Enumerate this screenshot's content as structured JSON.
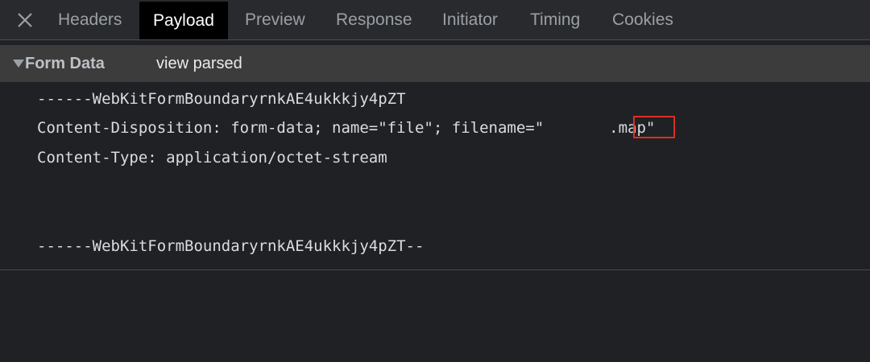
{
  "tabs": [
    {
      "label": "Headers",
      "active": false
    },
    {
      "label": "Payload",
      "active": true
    },
    {
      "label": "Preview",
      "active": false
    },
    {
      "label": "Response",
      "active": false
    },
    {
      "label": "Initiator",
      "active": false
    },
    {
      "label": "Timing",
      "active": false
    },
    {
      "label": "Cookies",
      "active": false
    }
  ],
  "close_icon": "close-icon",
  "section": {
    "title": "Form Data",
    "toggle_label": "view parsed",
    "expanded_icon": "triangle-down-icon"
  },
  "form_body": {
    "boundary_start": "------WebKitFormBoundaryrnkAE4ukkkjy4pZT",
    "disposition_prefix": "Content-Disposition: form-data; name=\"file\"; filename=\"",
    "disposition_highlight": ".map",
    "disposition_suffix": "\"",
    "content_type": "Content-Type: application/octet-stream",
    "boundary_end": "------WebKitFormBoundaryrnkAE4ukkkjy4pZT--"
  },
  "colors": {
    "background": "#202124",
    "tabbar": "#292a2d",
    "active_tab": "#000000",
    "section_header": "#3c3c3c",
    "highlight_border": "#d93025"
  }
}
